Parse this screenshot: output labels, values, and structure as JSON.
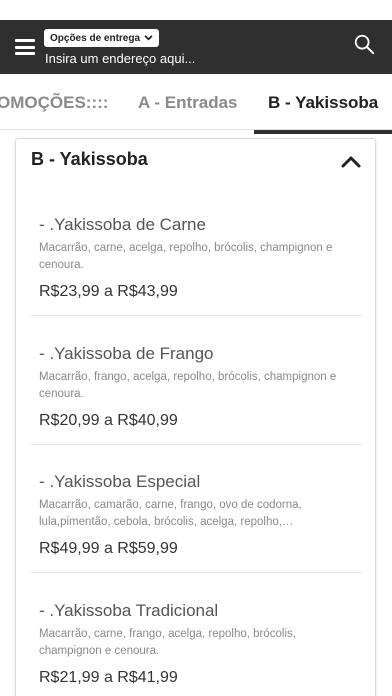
{
  "header": {
    "delivery_label": "Opções de entrega",
    "address_placeholder": "Insira um endereço aqui..."
  },
  "tabs": [
    {
      "label": "OMOÇÕES::::"
    },
    {
      "label": "A - Entradas"
    },
    {
      "label": "B - Yakissoba"
    }
  ],
  "section": {
    "title": "B - Yakissoba",
    "items": [
      {
        "name": "- .Yakissoba de Carne",
        "description": "Macarrão, carne, acelga, repolho, brócolis, champignon e cenoura.",
        "price": "R$23,99 a R$43,99"
      },
      {
        "name": "- .Yakissoba de Frango",
        "description": "Macarrão, frango, acelga, repolho, brócolis, champignon e cenoura.",
        "price": "R$20,99 a R$40,99"
      },
      {
        "name": "- .Yakissoba Especial",
        "description": "Macarrão, camarão, carne, frango, ovo de codorna, lula,pimentão, cebola, brócolis, acelga, repolho,…",
        "price": "R$49,99 a R$59,99"
      },
      {
        "name": "- .Yakissoba Tradicional",
        "description": "Macarrão, carne, frango, acelga, repolho, brócolis, champignon e cenoura.",
        "price": "R$21,99 a R$41,99"
      }
    ]
  },
  "icons": {
    "menu": "hamburger-icon",
    "dropdown": "chevron-down-icon",
    "search": "search-icon",
    "collapse": "chevron-up-icon"
  },
  "colors": {
    "header_bg": "#2f2f2f",
    "active_tab": "#222222",
    "inactive_tab": "#8a8a8a"
  }
}
